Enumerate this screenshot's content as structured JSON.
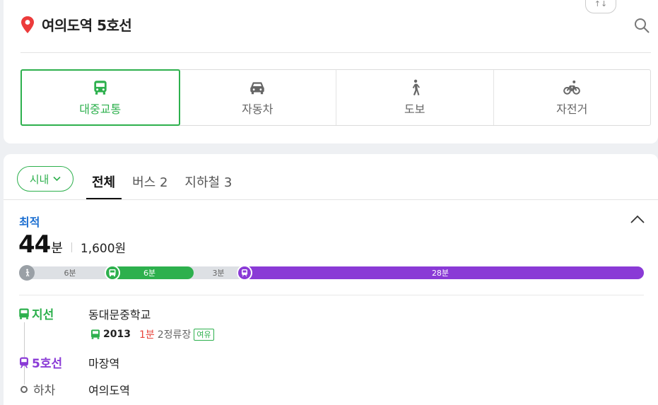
{
  "search": {
    "destination": "여의도역 5호선"
  },
  "modes": [
    {
      "label": "대중교통",
      "icon": "bus-icon",
      "active": true
    },
    {
      "label": "자동차",
      "icon": "car-icon",
      "active": false
    },
    {
      "label": "도보",
      "icon": "walk-icon",
      "active": false
    },
    {
      "label": "자전거",
      "icon": "bicycle-icon",
      "active": false
    }
  ],
  "filters": {
    "scope": "시내",
    "tabs": [
      {
        "label": "전체"
      },
      {
        "label": "버스 2"
      },
      {
        "label": "지하철 3"
      }
    ]
  },
  "route": {
    "badge": "최적",
    "time_value": "44",
    "time_unit": "분",
    "fare": "1,600원",
    "segments": [
      {
        "type": "walk",
        "label": "6분",
        "color": "#9aa0a6"
      },
      {
        "type": "bus",
        "label": "6분",
        "color": "#2db04d"
      },
      {
        "type": "walk",
        "label": "3분",
        "color": "#9aa0a6"
      },
      {
        "type": "subway",
        "label": "28분",
        "color": "#8a3ad6"
      }
    ],
    "steps": [
      {
        "tag": "지선",
        "name": "동대문중학교",
        "color": "#2db04d"
      },
      {
        "tag": "5호선",
        "name": "마장역",
        "color": "#8a3ad6"
      },
      {
        "tag": "하차",
        "name": "여의도역",
        "color": "#555555"
      }
    ],
    "bus": {
      "number": "2013",
      "eta": "1분",
      "stops": "2정류장",
      "crowd": "여유"
    }
  }
}
